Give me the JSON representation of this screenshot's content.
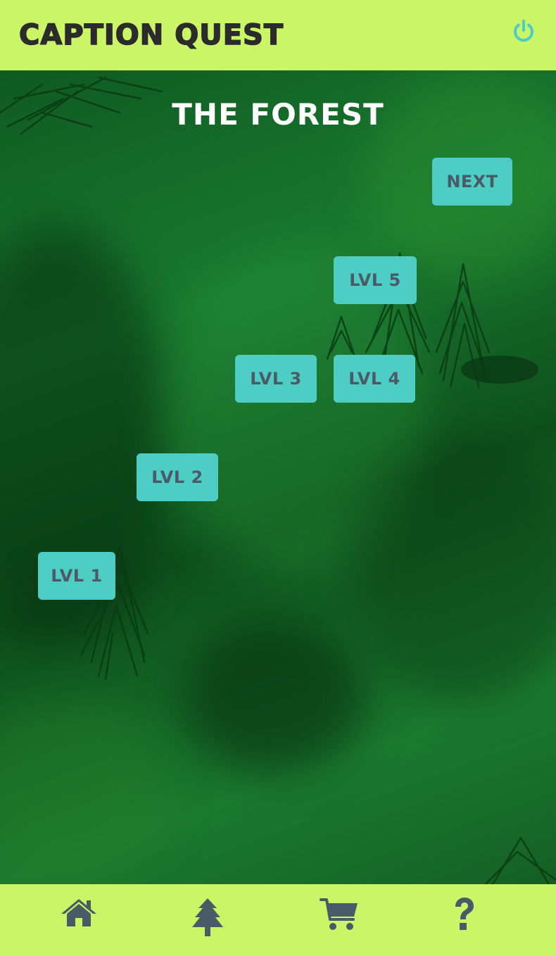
{
  "header": {
    "app_title": "CAPTION QUEST",
    "power_icon": "power-icon"
  },
  "world": {
    "title": "THE FOREST",
    "next_label": "NEXT",
    "levels": [
      "LVL 1",
      "LVL 2",
      "LVL 3",
      "LVL 4",
      "LVL 5"
    ]
  },
  "bottom_nav": {
    "items": [
      {
        "icon": "home-icon"
      },
      {
        "icon": "tree-icon"
      },
      {
        "icon": "cart-icon"
      },
      {
        "icon": "help-icon"
      }
    ]
  },
  "colors": {
    "bar_background": "#c9f566",
    "button_background": "#4ecdc4",
    "button_text": "#4a5a66",
    "power_icon": "#4ecdc4",
    "nav_icon": "#4a5a66",
    "forest_green": "#1a6b2a"
  }
}
